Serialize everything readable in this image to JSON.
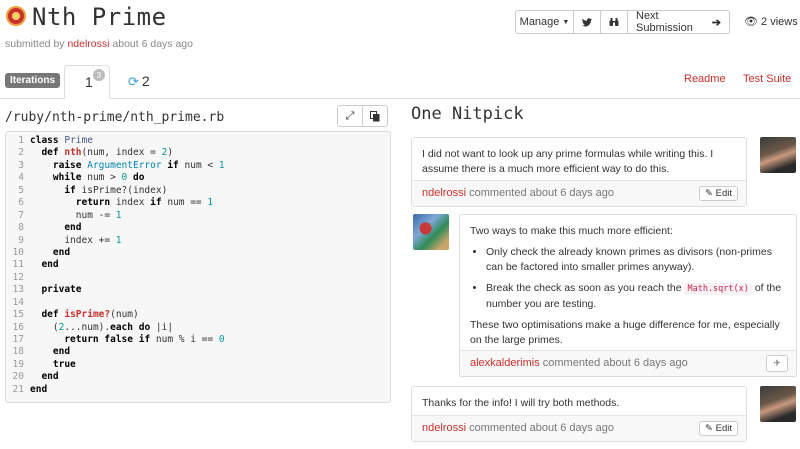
{
  "header": {
    "title": "Nth Prime",
    "submitted_prefix": "submitted by",
    "author": "ndelrossi",
    "submitted_suffix": "about 6 days ago",
    "manage_label": "Manage",
    "next_label": "Next Submission",
    "views": "2 views"
  },
  "tabs": {
    "iterations_label": "Iterations",
    "tab1_label": "1",
    "tab1_badge": "3",
    "tab2_label": "2",
    "readme_label": "Readme",
    "testsuite_label": "Test Suite"
  },
  "code": {
    "filepath": "/ruby/nth-prime/nth_prime.rb",
    "lines": [
      "class Prime",
      "  def nth(num, index = 2)",
      "    raise ArgumentError if num < 1",
      "    while num > 0 do",
      "      if isPrime?(index)",
      "        return index if num == 1",
      "        num -= 1",
      "      end",
      "      index += 1",
      "    end",
      "  end",
      "",
      "  private",
      "",
      "  def isPrime?(num)",
      "    (2...num).each do |i|",
      "      return false if num % i == 0",
      "    end",
      "    true",
      "  end",
      "end"
    ]
  },
  "nitpicks": {
    "title": "One Nitpick",
    "comments": [
      {
        "author": "ndelrossi",
        "time": "commented about 6 days ago",
        "text": "I did not want to look up any prime formulas while writing this. I assume there is a much more efficient way to do this.",
        "action": "Edit"
      },
      {
        "author": "alexkalderimis",
        "time": "commented about 6 days ago",
        "intro": "Two ways to make this much more efficient:",
        "bullet1": "Only check the already known primes as divisors (non-primes can be factored into smaller primes anyway).",
        "bullet2_pre": "Break the check as soon as you reach the",
        "bullet2_code": "Math.sqrt(x)",
        "bullet2_post": "of the number you are testing.",
        "outro": "These two optimisations make a huge difference for me, especially on the large primes."
      },
      {
        "author": "ndelrossi",
        "time": "commented about 6 days ago",
        "text": "Thanks for the info! I will try both methods.",
        "action": "Edit"
      }
    ]
  },
  "colors": {
    "accent": "#c9302c",
    "sync_icon": "#3aa0d8"
  }
}
